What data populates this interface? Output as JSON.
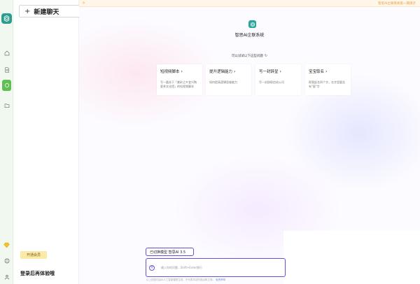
{
  "notice": {
    "icon": "notification-icon",
    "link_text": "智思AI企联系统第一期演示"
  },
  "sidebar": {
    "new_chat_label": "新建聊天",
    "vip_button_label": "开通会员",
    "login_tip": "登录后再体验哦"
  },
  "rail": {
    "items": [
      "home-icon",
      "document-icon",
      "chat-icon",
      "folder-icon"
    ],
    "bottom": [
      "vip-icon",
      "info-icon",
      "user-icon"
    ],
    "accent": "#5fbf53"
  },
  "main": {
    "brand_title": "智思AI企联系统",
    "hint": "可以试试以下这些问题",
    "cards": [
      {
        "title": "短视频脚本",
        "desc": "写一篇关于「紫砂之乡宜兴陶瓷茶文化馆」的短视频脚本"
      },
      {
        "title": "提升逻辑能力",
        "desc": "如何提高逻辑思维能力"
      },
      {
        "title": "写一封辞呈",
        "desc": "写一封辞职信给公司"
      },
      {
        "title": "宝宝取名",
        "desc": "帮我起名四个字，名字里要含有\"宸\"字"
      }
    ],
    "model_label": "已切换模型 智思AI 3.5",
    "input_placeholder": "输入你的问题...Shift+Enter换行",
    "disclaimer": "以上回答均由AI人工智能模型生成，不代表本站的观点和立场。",
    "disclaimer_link": "免责声明"
  },
  "colors": {
    "brand": "#2aa59a",
    "input_border": "#6650d8",
    "notice_bg": "#fff5e8"
  }
}
